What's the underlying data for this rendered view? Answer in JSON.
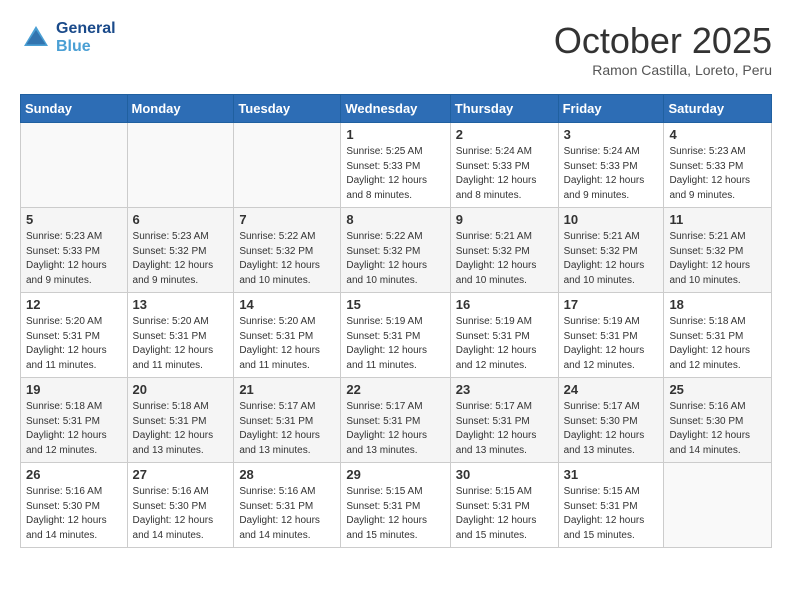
{
  "logo": {
    "line1": "General",
    "line2": "Blue"
  },
  "title": "October 2025",
  "location": "Ramon Castilla, Loreto, Peru",
  "days_of_week": [
    "Sunday",
    "Monday",
    "Tuesday",
    "Wednesday",
    "Thursday",
    "Friday",
    "Saturday"
  ],
  "weeks": [
    [
      {
        "num": "",
        "sunrise": "",
        "sunset": "",
        "daylight": ""
      },
      {
        "num": "",
        "sunrise": "",
        "sunset": "",
        "daylight": ""
      },
      {
        "num": "",
        "sunrise": "",
        "sunset": "",
        "daylight": ""
      },
      {
        "num": "1",
        "sunrise": "5:25 AM",
        "sunset": "5:33 PM",
        "daylight": "12 hours and 8 minutes."
      },
      {
        "num": "2",
        "sunrise": "5:24 AM",
        "sunset": "5:33 PM",
        "daylight": "12 hours and 8 minutes."
      },
      {
        "num": "3",
        "sunrise": "5:24 AM",
        "sunset": "5:33 PM",
        "daylight": "12 hours and 9 minutes."
      },
      {
        "num": "4",
        "sunrise": "5:23 AM",
        "sunset": "5:33 PM",
        "daylight": "12 hours and 9 minutes."
      }
    ],
    [
      {
        "num": "5",
        "sunrise": "5:23 AM",
        "sunset": "5:33 PM",
        "daylight": "12 hours and 9 minutes."
      },
      {
        "num": "6",
        "sunrise": "5:23 AM",
        "sunset": "5:32 PM",
        "daylight": "12 hours and 9 minutes."
      },
      {
        "num": "7",
        "sunrise": "5:22 AM",
        "sunset": "5:32 PM",
        "daylight": "12 hours and 10 minutes."
      },
      {
        "num": "8",
        "sunrise": "5:22 AM",
        "sunset": "5:32 PM",
        "daylight": "12 hours and 10 minutes."
      },
      {
        "num": "9",
        "sunrise": "5:21 AM",
        "sunset": "5:32 PM",
        "daylight": "12 hours and 10 minutes."
      },
      {
        "num": "10",
        "sunrise": "5:21 AM",
        "sunset": "5:32 PM",
        "daylight": "12 hours and 10 minutes."
      },
      {
        "num": "11",
        "sunrise": "5:21 AM",
        "sunset": "5:32 PM",
        "daylight": "12 hours and 10 minutes."
      }
    ],
    [
      {
        "num": "12",
        "sunrise": "5:20 AM",
        "sunset": "5:31 PM",
        "daylight": "12 hours and 11 minutes."
      },
      {
        "num": "13",
        "sunrise": "5:20 AM",
        "sunset": "5:31 PM",
        "daylight": "12 hours and 11 minutes."
      },
      {
        "num": "14",
        "sunrise": "5:20 AM",
        "sunset": "5:31 PM",
        "daylight": "12 hours and 11 minutes."
      },
      {
        "num": "15",
        "sunrise": "5:19 AM",
        "sunset": "5:31 PM",
        "daylight": "12 hours and 11 minutes."
      },
      {
        "num": "16",
        "sunrise": "5:19 AM",
        "sunset": "5:31 PM",
        "daylight": "12 hours and 12 minutes."
      },
      {
        "num": "17",
        "sunrise": "5:19 AM",
        "sunset": "5:31 PM",
        "daylight": "12 hours and 12 minutes."
      },
      {
        "num": "18",
        "sunrise": "5:18 AM",
        "sunset": "5:31 PM",
        "daylight": "12 hours and 12 minutes."
      }
    ],
    [
      {
        "num": "19",
        "sunrise": "5:18 AM",
        "sunset": "5:31 PM",
        "daylight": "12 hours and 12 minutes."
      },
      {
        "num": "20",
        "sunrise": "5:18 AM",
        "sunset": "5:31 PM",
        "daylight": "12 hours and 13 minutes."
      },
      {
        "num": "21",
        "sunrise": "5:17 AM",
        "sunset": "5:31 PM",
        "daylight": "12 hours and 13 minutes."
      },
      {
        "num": "22",
        "sunrise": "5:17 AM",
        "sunset": "5:31 PM",
        "daylight": "12 hours and 13 minutes."
      },
      {
        "num": "23",
        "sunrise": "5:17 AM",
        "sunset": "5:31 PM",
        "daylight": "12 hours and 13 minutes."
      },
      {
        "num": "24",
        "sunrise": "5:17 AM",
        "sunset": "5:30 PM",
        "daylight": "12 hours and 13 minutes."
      },
      {
        "num": "25",
        "sunrise": "5:16 AM",
        "sunset": "5:30 PM",
        "daylight": "12 hours and 14 minutes."
      }
    ],
    [
      {
        "num": "26",
        "sunrise": "5:16 AM",
        "sunset": "5:30 PM",
        "daylight": "12 hours and 14 minutes."
      },
      {
        "num": "27",
        "sunrise": "5:16 AM",
        "sunset": "5:30 PM",
        "daylight": "12 hours and 14 minutes."
      },
      {
        "num": "28",
        "sunrise": "5:16 AM",
        "sunset": "5:31 PM",
        "daylight": "12 hours and 14 minutes."
      },
      {
        "num": "29",
        "sunrise": "5:15 AM",
        "sunset": "5:31 PM",
        "daylight": "12 hours and 15 minutes."
      },
      {
        "num": "30",
        "sunrise": "5:15 AM",
        "sunset": "5:31 PM",
        "daylight": "12 hours and 15 minutes."
      },
      {
        "num": "31",
        "sunrise": "5:15 AM",
        "sunset": "5:31 PM",
        "daylight": "12 hours and 15 minutes."
      },
      {
        "num": "",
        "sunrise": "",
        "sunset": "",
        "daylight": ""
      }
    ]
  ]
}
